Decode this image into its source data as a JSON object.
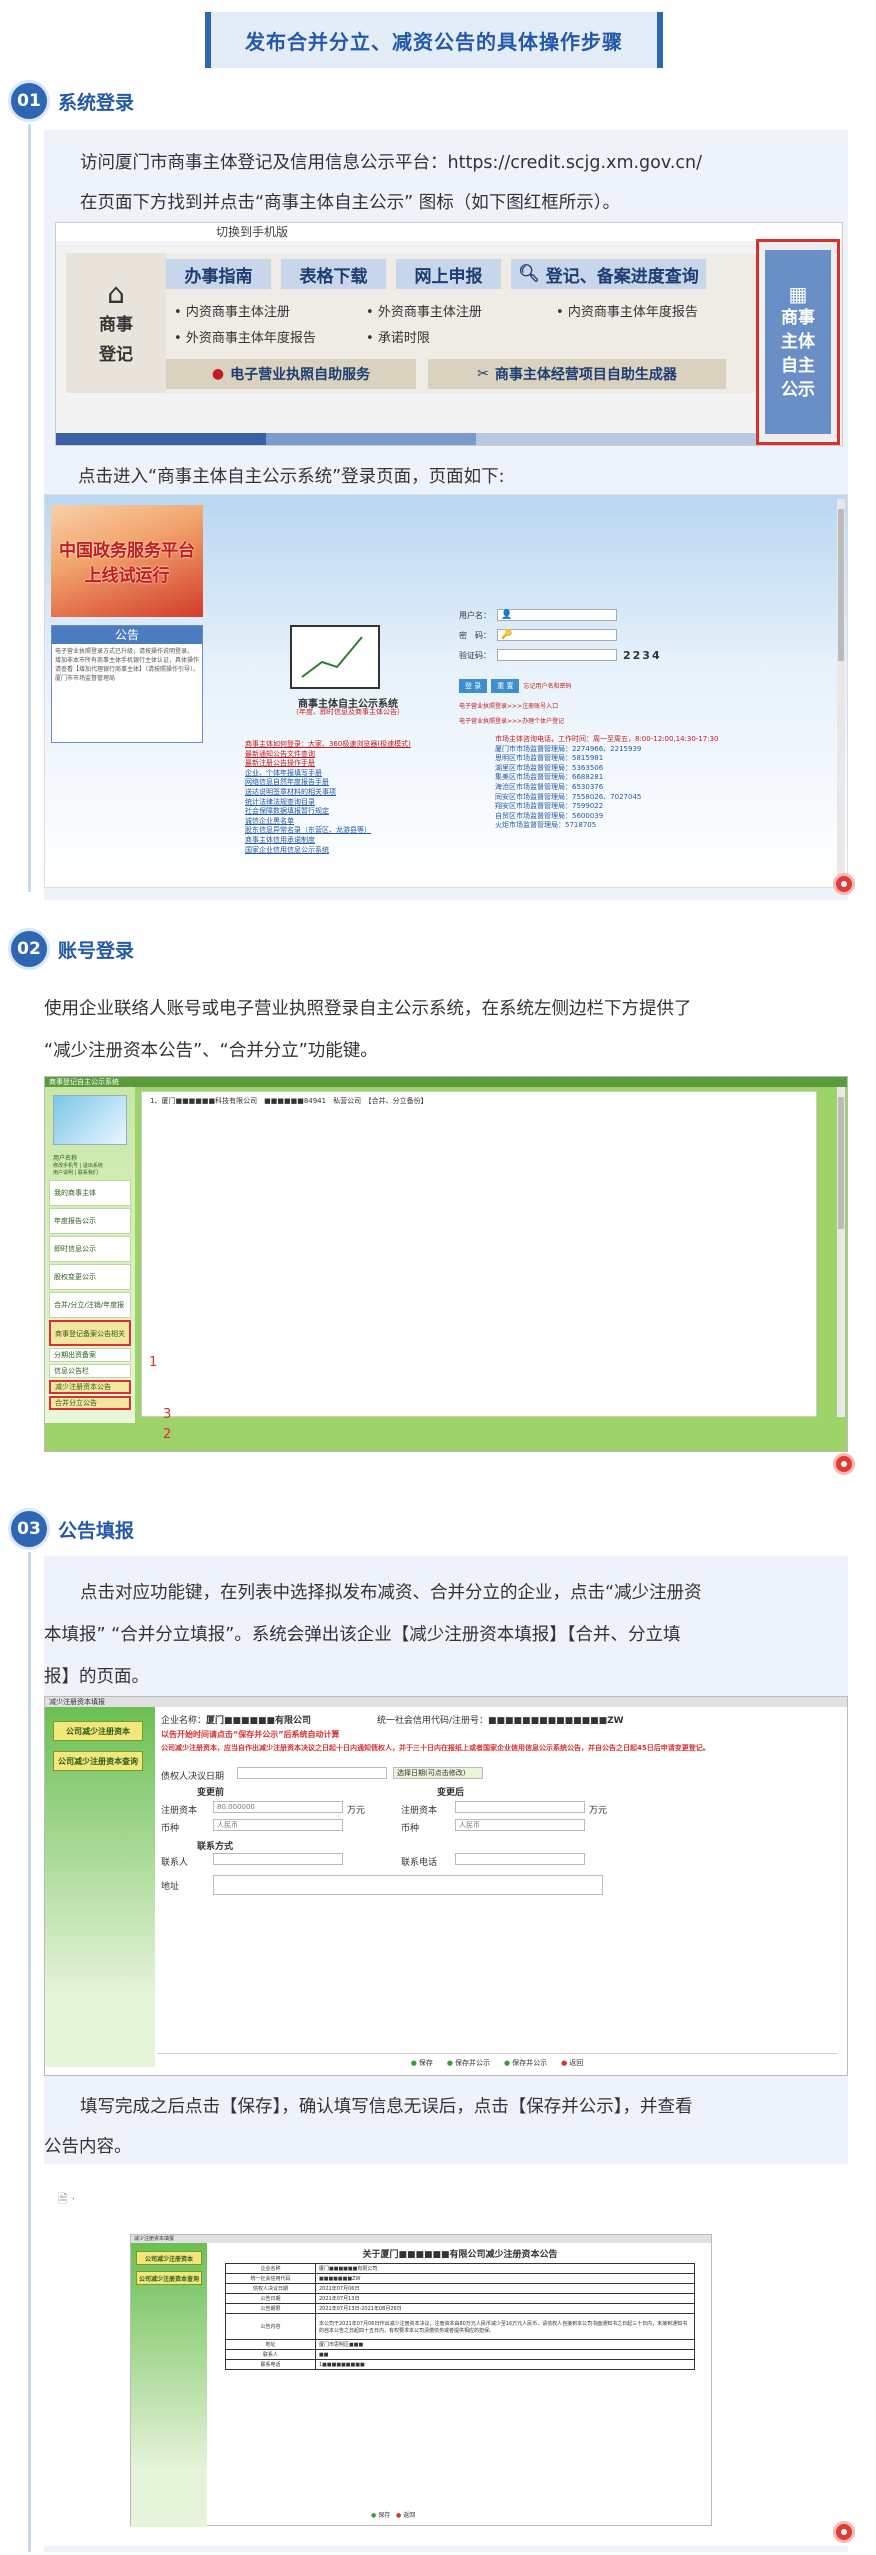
{
  "header": {
    "title": "发布合并分立、减资公告的具体操作步骤"
  },
  "colors": {
    "accent": "#2f66b3",
    "card_bg": "#eef3fb",
    "highlight_red": "#d93030"
  },
  "s1": {
    "num": "01",
    "title": "系统登录",
    "p1": "访问厦门市商事主体登记及信用信息公示平台：https://credit.scjg.xm.gov.cn/",
    "p2": "在页面下方找到并点击“商事主体自主公示” 图标（如下图红框所示）。",
    "shot": {
      "topbar": "切换到手机版",
      "left_label1": "商事",
      "left_label2": "登记",
      "tabs": [
        "办事指南",
        "表格下载",
        "网上申报",
        "登记、备案进度查询"
      ],
      "bullets": [
        "内资商事主体注册",
        "外资商事主体注册",
        "内资商事主体年度报告",
        "外资商事主体年度报告",
        "承诺时限"
      ],
      "btn1": "电子营业执照自助服务",
      "btn2": "商事主体经营项目自助生成器",
      "right_label": [
        "商事",
        "主体",
        "自主",
        "公示"
      ]
    },
    "p3": "点击进入“商事主体自主公示系统”登录页面，页面如下:"
  },
  "s1b": {
    "banner": [
      "中国政务服务平台",
      "上线试运行"
    ],
    "notice_title": "公告",
    "notice_body": "电子营业执照登录方式已升级，请按操作说明登录。 增加非本市所有商事主体手机银行主体认证，具体操作请查看【增加代理银行商事主体】（请按照操作引导）。 厦门市市场监督管理局",
    "sys_title": "商事主体自主公示系统",
    "sys_sub": "（年度、即时信息及商事主体公告）",
    "user_label": "用户名：",
    "pwd_label": "密　码：",
    "code_label": "验证码：",
    "code": "2234",
    "btn_login": "登 录",
    "btn_reset": "重 置",
    "forgot": "忘记用户名和密码",
    "tip1": "电子营业执照登录>>>注册账号入口",
    "tip2": "电子营业执照登录>>>办理个体户登记",
    "links": [
      "商事主体如何登录：大家、360极速浏览器(极速模式)",
      "最新通知公告文件查询",
      "最新注册公告操作手册",
      "企业、个体年报填写手册",
      "网络信息自然年度报告手册",
      "送达说明签章材料的相关事项",
      "统计法律法规查询目录",
      "社会保障数据填报暂行规定",
      "诚信企业黑名单",
      "股东信息异常名录（东营区、龙游县等）",
      "商事主体信用承诺制度",
      "国家企业信用信息公示系统"
    ],
    "contact_head": "市场主体咨询电话，工作时间：周一至周五，8:00-12:00,14:30-17:30",
    "contact": [
      "厦门市市场监督管理局：2274966、2215939",
      "思明区市场监督管理局：5815981",
      "湖里区市场监督管理局：5363506",
      "集美区市场监督管理局：6688281",
      "海沧区市场监督管理局：6530376",
      "同安区市场监督管理局：7558026、7027045",
      "翔安区市场监督管理局：7599022",
      "自贸区市场监督管理局：5600039",
      "火炬市场监督管理局：5718705"
    ]
  },
  "s2": {
    "num": "02",
    "title": "账号登录",
    "p1": "使用企业联络人账号或电子营业执照登录自主公示系统，在系统左侧边栏下方提供了",
    "p2": "“减少注册资本公告”、“合并分立”功能键。",
    "shot": {
      "topbar": "商事登记自主公示系统",
      "row": "1、厦门■■■■■■科技有限公司　■■■■■■84941　私营公司　【合并、分立备份】",
      "user_label": "用户名称",
      "links": [
        "修改手机号 | 退出系统",
        "用户说明 | 联系我们"
      ],
      "menu": [
        "我的商事主体",
        "年度报告公示",
        "即时信息公示",
        "股权变更公示",
        "合并/分立/注销/年度报告公示",
        "商事登记备案公告相关公告",
        "分期出资备案",
        "信息公告栏",
        "减少注册资本公告",
        "合并分立公告"
      ],
      "marks": [
        "1",
        "3",
        "2"
      ]
    }
  },
  "s3": {
    "num": "03",
    "title": "公告填报",
    "p1": "点击对应功能键，在列表中选择拟发布减资、合并分立的企业，点击“减少注册资",
    "p2": "本填报” “合并分立填报”。系统会弹出该企业【减少注册资本填报】【合并、分立填",
    "p3": "报】的页面。",
    "shot": {
      "topbar": "减少注册资本填报",
      "side_btns": [
        "公司减少注册资本",
        "公司减少注册资本查询"
      ],
      "company_label": "企业名称：",
      "company_value": "厦门■■■■■■有限公司",
      "credit_label": "统一社会信用代码/注册号：",
      "credit_value": "■■■■■■■■■■■■■■ZW",
      "warn1": "以告开始时间请点击“保存并公示”后系统自动计算",
      "warn2": "公司减少注册资本，应当自作出减少注册资本决议之日起十日内通知债权人，并于三十日内在报纸上或者国家企业信用信息公示系统公告，并自公告之日起45日后申请变更登记。",
      "date_label": "债权人决议日期",
      "date_btn": "选择日期(可点击修改)",
      "before": "变更前",
      "after": "变更后",
      "cap_label": "注册资本",
      "cap_value": "80.000000",
      "cap_unit": "万元",
      "cur_label": "币种",
      "cur_value": "人民币",
      "contact_head": "联系方式",
      "contact_person": "联系人",
      "contact_phone": "联系电话",
      "addr": "地址",
      "footer": [
        "保存",
        "保存并公示",
        "保存并公示",
        "返回"
      ]
    },
    "p4": "填写完成之后点击【保存】，确认填写信息无误后，点击【保存并公示】，并查看",
    "p5": "公告内容。",
    "shot2": {
      "topbar": "减少注册资本填报",
      "side_btns": [
        "公司减少注册资本",
        "公司减少注册资本查询"
      ],
      "doc_title": "关于厦门■■■■■■有限公司减少注册资本公告",
      "rows": [
        [
          "企业名称",
          "厦门■■■■■■有限公司"
        ],
        [
          "统一社会信用代码",
          "■■■■■■■ZW"
        ],
        [
          "债权人决议日期",
          "2021年07月06日"
        ],
        [
          "公告日期",
          "2021年07月13日"
        ],
        [
          "公告期限",
          "2021年07月13日-2021年08月26日"
        ],
        [
          "公告内容",
          "本公司于2021年07月06日作出减少注册资本决议，注册资本由80万元人民币减少至16万元人民币，请债权人自接到本公司书面通知书之日起三十日内，未接到通知书的自本公告之日起四十五日内，有权要求本公司清偿债务或者提供相应的担保。"
        ],
        [
          "地址",
          "厦门市思明区■■■"
        ],
        [
          "联系人",
          "■■"
        ],
        [
          "联系电话",
          "1■■■■■■■■■"
        ]
      ],
      "footer": [
        "保存",
        "返回"
      ]
    }
  }
}
